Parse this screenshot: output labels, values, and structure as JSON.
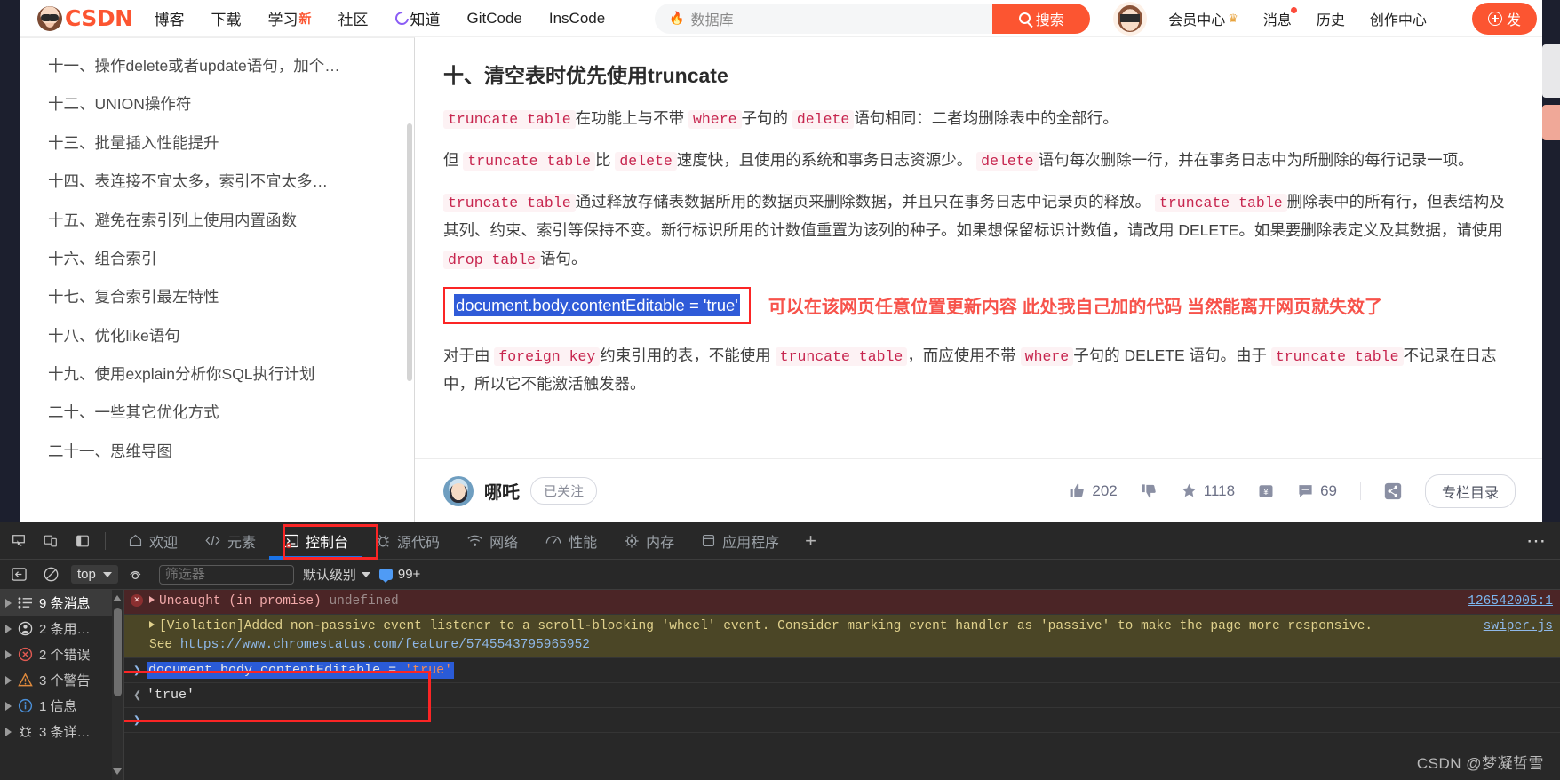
{
  "header": {
    "brand": "CSDN",
    "nav": [
      {
        "label": "博客",
        "badge": ""
      },
      {
        "label": "下载",
        "badge": ""
      },
      {
        "label": "学习",
        "badge": "新"
      },
      {
        "label": "社区",
        "badge": ""
      },
      {
        "label": "知道",
        "badge": "",
        "icon": "c-circle-icon"
      },
      {
        "label": "GitCode",
        "badge": ""
      },
      {
        "label": "InsCode",
        "badge": ""
      }
    ],
    "search": {
      "value": "数据库",
      "placeholder": "数据库",
      "button": "搜索",
      "flame": "🔥"
    },
    "right_nav": [
      {
        "label": "会员中心",
        "crown": true,
        "dot": false
      },
      {
        "label": "消息",
        "crown": false,
        "dot": true
      },
      {
        "label": "历史",
        "crown": false,
        "dot": false
      },
      {
        "label": "创作中心",
        "crown": false,
        "dot": false
      }
    ],
    "publish_label": "发"
  },
  "toc": {
    "items": [
      "十一、操作delete或者update语句，加个…",
      "十二、UNION操作符",
      "十三、批量插入性能提升",
      "十四、表连接不宜太多，索引不宜太多…",
      "十五、避免在索引列上使用内置函数",
      "十六、组合索引",
      "十七、复合索引最左特性",
      "十八、优化like语句",
      "十九、使用explain分析你SQL执行计划",
      "二十、一些其它优化方式",
      "二十一、思维导图"
    ]
  },
  "article": {
    "heading": "十、清空表时优先使用truncate",
    "p1": {
      "c1": "truncate table",
      "t1": "在功能上与不带",
      "c2": "where",
      "t2": "子句的",
      "c3": "delete",
      "t3": "语句相同：二者均删除表中的全部行。"
    },
    "p2": {
      "t0": "但",
      "c1": "truncate table",
      "t1": "比",
      "c2": "delete",
      "t2": "速度快，且使用的系统和事务日志资源少。",
      "c3": "delete",
      "t3": "语句每次删除一行，并在事务日志中为所删除的每行记录一项。"
    },
    "p3": {
      "c1": "truncate table",
      "t1": "通过释放存储表数据所用的数据页来删除数据，并且只在事务日志中记录页的释放。",
      "c2": "truncate table",
      "t2": "删除表中的所有行，但表结构及其列、约束、索引等保持不变。新行标识所用的计数值重置为该列的种子。如果想保留标识计数值，请改用 DELETE。如果要删除表定义及其数据，请使用",
      "c3": "drop table",
      "t3": "语句。"
    },
    "selected_code": "document.body.contentEditable = 'true'",
    "red_annotation": "可以在该网页任意位置更新内容  此处我自己加的代码 当然能离开网页就失效了",
    "p4": {
      "t0": "对于由",
      "c1": "foreign key",
      "t1": "约束引用的表，不能使用",
      "c2": "truncate table",
      "t2": "，而应使用不带",
      "c3": "where",
      "t3": "子句的 DELETE 语句。由于",
      "c4": "truncate table",
      "t4": "不记录在日志中，所以它不能激活触发器。"
    }
  },
  "author_bar": {
    "name": "哪吒",
    "follow": "已关注",
    "likes": "202",
    "stars": "1118",
    "comments": "69",
    "catalog": "专栏目录"
  },
  "devtools": {
    "tabs": [
      {
        "label": "欢迎",
        "icon": "home-icon",
        "active": false
      },
      {
        "label": "元素",
        "icon": "code-brackets-icon",
        "active": false
      },
      {
        "label": "控制台",
        "icon": "console-icon",
        "active": true
      },
      {
        "label": "源代码",
        "icon": "bug-icon",
        "active": false
      },
      {
        "label": "网络",
        "icon": "wifi-icon",
        "active": false
      },
      {
        "label": "性能",
        "icon": "gauge-icon",
        "active": false
      },
      {
        "label": "内存",
        "icon": "chip-icon",
        "active": false
      },
      {
        "label": "应用程序",
        "icon": "database-icon",
        "active": false
      }
    ],
    "add_tab": "+",
    "more": "⋯",
    "filter_bar": {
      "context": "top",
      "filter_placeholder": "筛选器",
      "level": "默认级别",
      "issues": "99+"
    },
    "sidebar": [
      {
        "label": "9 条消息",
        "icon": "list-icon",
        "selected": true
      },
      {
        "label": "2 条用…",
        "icon": "user-icon",
        "selected": false
      },
      {
        "label": "2 个错误",
        "icon": "error-icon",
        "selected": false
      },
      {
        "label": "3 个警告",
        "icon": "warning-icon",
        "selected": false
      },
      {
        "label": "1 信息",
        "icon": "info-icon",
        "selected": false
      },
      {
        "label": "3 条详…",
        "icon": "bug-icon",
        "selected": false
      }
    ],
    "messages": {
      "m1": {
        "text": "Uncaught (in promise)",
        "dim": "undefined",
        "source": "126542005:1"
      },
      "m2": {
        "line1": "[Violation]Added non-passive event listener to a scroll-blocking 'wheel' event. Consider marking event handler as 'passive' to make the page more responsive.",
        "see": "See",
        "url": "https://www.chromestatus.com/feature/5745543795965952",
        "source": "swiper.js"
      },
      "input": "document.body.contentEditable = ",
      "input_str": "'true'",
      "output": "'true'"
    },
    "watermark": "CSDN @梦凝哲雪"
  },
  "colors": {
    "brand": "#fc5531",
    "accent_blue": "#1a73e8",
    "annotation_red": "#fb2525",
    "selection_blue": "#2a5bd7",
    "code_pink": "#c7254e"
  }
}
